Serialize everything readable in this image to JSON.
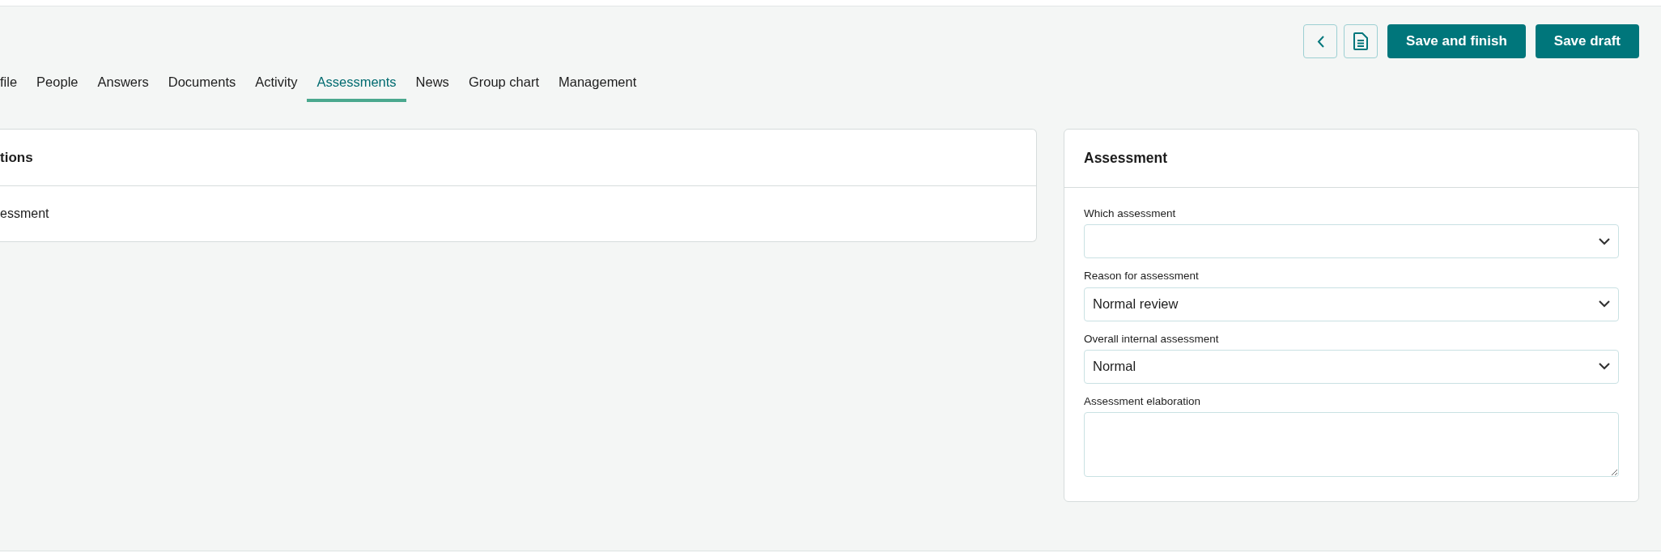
{
  "toolbar": {
    "buttons": [
      {
        "kind": "back"
      },
      {
        "kind": "document"
      },
      {
        "kind": "primary",
        "label": "Save and finish"
      },
      {
        "kind": "primary",
        "label": "Save draft"
      }
    ]
  },
  "tabs": [
    {
      "label": "file",
      "selected": false
    },
    {
      "label": "People",
      "selected": false
    },
    {
      "label": "Answers",
      "selected": false
    },
    {
      "label": "Documents",
      "selected": false
    },
    {
      "label": "Activity",
      "selected": false
    },
    {
      "label": "Assessments",
      "selected": true
    },
    {
      "label": "News",
      "selected": false
    },
    {
      "label": "Group chart",
      "selected": false
    },
    {
      "label": "Management",
      "selected": false
    }
  ],
  "left_card": {
    "title": "tions",
    "rows": [
      "essment"
    ]
  },
  "assessment_card": {
    "title": "Assessment",
    "fields": [
      {
        "kind": "select",
        "label": "Which assessment"
      },
      {
        "kind": "select",
        "label": "Reason for assessment",
        "value": "Normal review"
      },
      {
        "kind": "select",
        "label": "Overall internal assessment",
        "value": "Normal"
      },
      {
        "kind": "textarea",
        "label": "Assessment elaboration"
      }
    ]
  }
}
